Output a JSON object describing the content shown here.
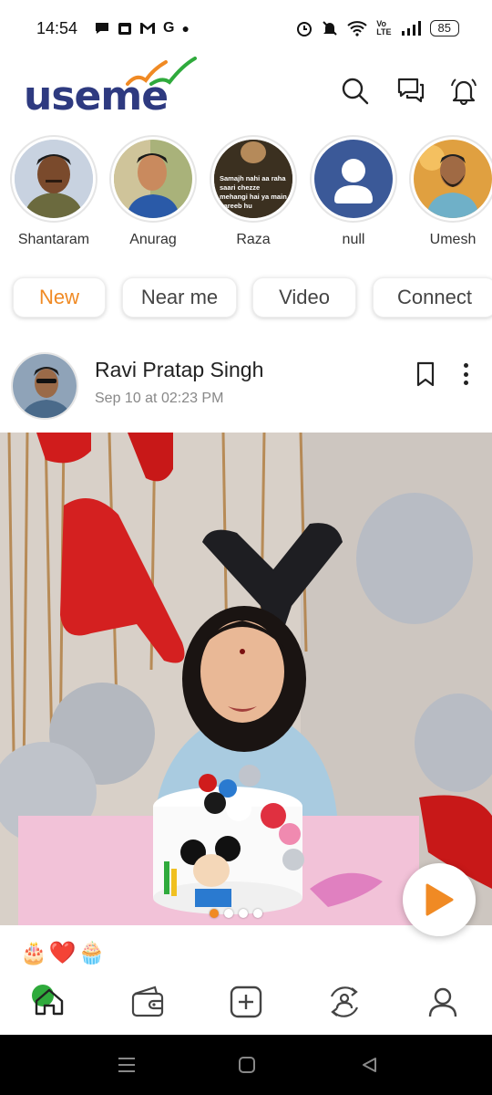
{
  "status_bar": {
    "time": "14:54",
    "left_icons": [
      "chat-bubble-icon",
      "calendar-icon",
      "gmail-icon",
      "google-icon",
      "dot-icon"
    ],
    "battery": "85"
  },
  "header": {
    "logo_text": "useme",
    "brand_colors": {
      "primary": "#2e3a80",
      "accent_orange": "#f08a24",
      "accent_green": "#2faa3c"
    },
    "icons": [
      "search-icon",
      "chat-icon",
      "bell-icon"
    ]
  },
  "stories": [
    {
      "name": "Shantaram"
    },
    {
      "name": "Anurag"
    },
    {
      "name": "Raza",
      "caption": "Samajh nahi aa raha saari chezze mehangi hai ya main gareeb hu"
    },
    {
      "name": "null"
    },
    {
      "name": "Umesh"
    }
  ],
  "filters": [
    {
      "label": "New",
      "active": true
    },
    {
      "label": "Near me",
      "active": false
    },
    {
      "label": "Video",
      "active": false
    },
    {
      "label": "Connect",
      "active": false
    }
  ],
  "post": {
    "author": "Ravi Pratap Singh",
    "timestamp": "Sep 10 at 02:23 PM",
    "image_slide_count": 4,
    "image_active_slide": 1,
    "reactions": [
      "🎂",
      "❤️",
      "🧁"
    ]
  },
  "bottom_nav": {
    "items": [
      "home-icon",
      "wallet-icon",
      "add-post-icon",
      "connections-icon",
      "profile-icon"
    ],
    "active_index": 0
  },
  "system_nav": [
    "recents-icon",
    "home-button-icon",
    "back-icon"
  ]
}
